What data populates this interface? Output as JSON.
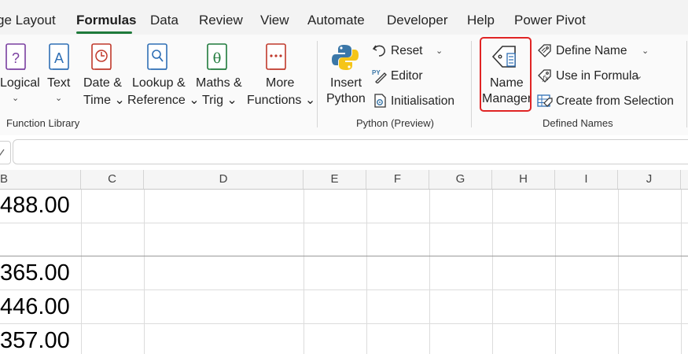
{
  "tabs": [
    {
      "label": "ge Layout"
    },
    {
      "label": "Formulas",
      "active": true
    },
    {
      "label": "Data"
    },
    {
      "label": "Review"
    },
    {
      "label": "View"
    },
    {
      "label": "Automate"
    },
    {
      "label": "Developer"
    },
    {
      "label": "Help"
    },
    {
      "label": "Power Pivot"
    }
  ],
  "function_library": {
    "group_label": "Function Library",
    "logical": {
      "line1": "Logical",
      "line2": "⌄"
    },
    "text": {
      "line1": "Text",
      "line2": "⌄"
    },
    "date_time": {
      "line1": "Date &",
      "line2": "Time ⌄"
    },
    "lookup": {
      "line1": "Lookup &",
      "line2": "Reference ⌄"
    },
    "maths": {
      "line1": "Maths &",
      "line2": "Trig ⌄"
    },
    "more": {
      "line1": "More",
      "line2": "Functions ⌄"
    }
  },
  "python": {
    "group_label": "Python (Preview)",
    "insert": {
      "line1": "Insert",
      "line2": "Python"
    },
    "reset": "Reset",
    "editor": "Editor",
    "initialisation": "Initialisation"
  },
  "defined_names": {
    "group_label": "Defined Names",
    "name_manager": {
      "line1": "Name",
      "line2": "Manager"
    },
    "define_name": "Define Name",
    "use_in_formula": "Use in Formula",
    "create_from_selection": "Create from Selection"
  },
  "columns": [
    "B",
    "C",
    "D",
    "E",
    "F",
    "G",
    "H",
    "I",
    "J"
  ],
  "cells": [
    {
      "value": "488.00"
    },
    {
      "value": ""
    },
    {
      "value": "365.00"
    },
    {
      "value": "446.00"
    },
    {
      "value": "357.00"
    }
  ],
  "colors": {
    "accent_green": "#1f7a3b",
    "highlight_red": "#e02424"
  }
}
